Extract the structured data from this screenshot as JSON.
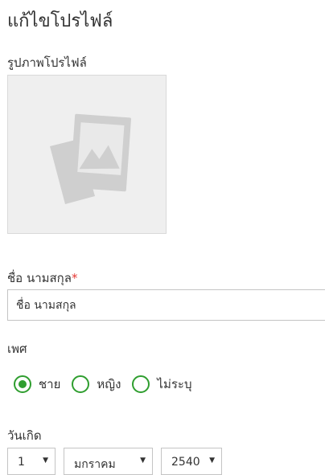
{
  "page": {
    "title": "แก้ไขโปรไฟล์"
  },
  "profile_photo": {
    "label": "รูปภาพโปรไฟล์",
    "icon": "image-placeholder-icon"
  },
  "name_field": {
    "label": "ชื่อ นามสกุล",
    "required_mark": "*",
    "placeholder": "ชื่อ นามสกุล"
  },
  "gender": {
    "label": "เพศ",
    "options": [
      {
        "label": "ชาย",
        "selected": true
      },
      {
        "label": "หญิง",
        "selected": false
      },
      {
        "label": "ไม่ระบุ",
        "selected": false
      }
    ],
    "accent_color": "#2f9e2f"
  },
  "birthday": {
    "label": "วันเกิด",
    "day": "1",
    "month": "มกราคม",
    "year": "2540"
  },
  "colors": {
    "required": "#e53935",
    "border": "#c4c4c4",
    "photo_bg": "#efefef"
  }
}
